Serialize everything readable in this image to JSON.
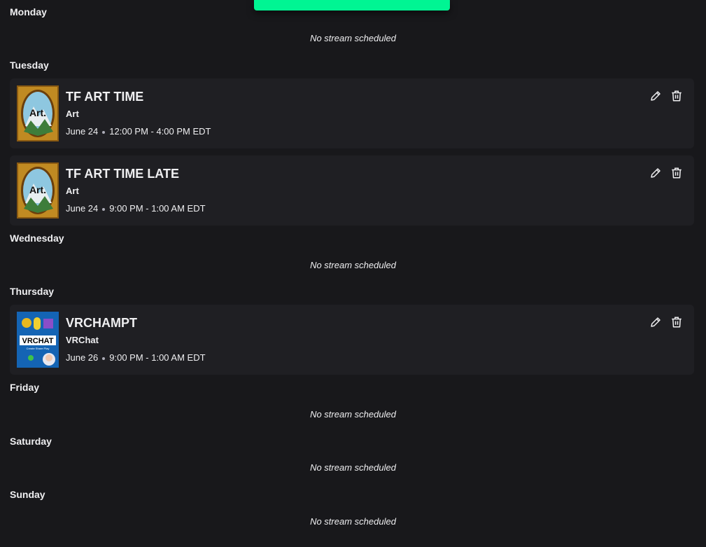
{
  "days": {
    "monday": {
      "label": "Monday",
      "empty_text": "No stream scheduled"
    },
    "tuesday": {
      "label": "Tuesday"
    },
    "wednesday": {
      "label": "Wednesday",
      "empty_text": "No stream scheduled"
    },
    "thursday": {
      "label": "Thursday"
    },
    "friday": {
      "label": "Friday",
      "empty_text": "No stream scheduled"
    },
    "saturday": {
      "label": "Saturday",
      "empty_text": "No stream scheduled"
    },
    "sunday": {
      "label": "Sunday",
      "empty_text": "No stream scheduled"
    }
  },
  "streams": [
    {
      "title": "TF ART TIME",
      "category": "Art",
      "date": "June 24",
      "time": "12:00 PM - 4:00 PM EDT",
      "thumb_text": "Art."
    },
    {
      "title": "TF ART TIME LATE",
      "category": "Art",
      "date": "June 24",
      "time": "9:00 PM - 1:00 AM EDT",
      "thumb_text": "Art."
    },
    {
      "title": "VRCHAMPT",
      "category": "VRChat",
      "date": "June 26",
      "time": "9:00 PM - 1:00 AM EDT",
      "thumb_text": "VRCHAT",
      "thumb_subtext": "Create Share Play"
    }
  ],
  "icons": {
    "edit": "pencil-icon",
    "delete": "trash-icon"
  },
  "colors": {
    "background": "#18181b",
    "card": "#1f1f23",
    "toast": "#00f593",
    "text": "#efeff1"
  }
}
